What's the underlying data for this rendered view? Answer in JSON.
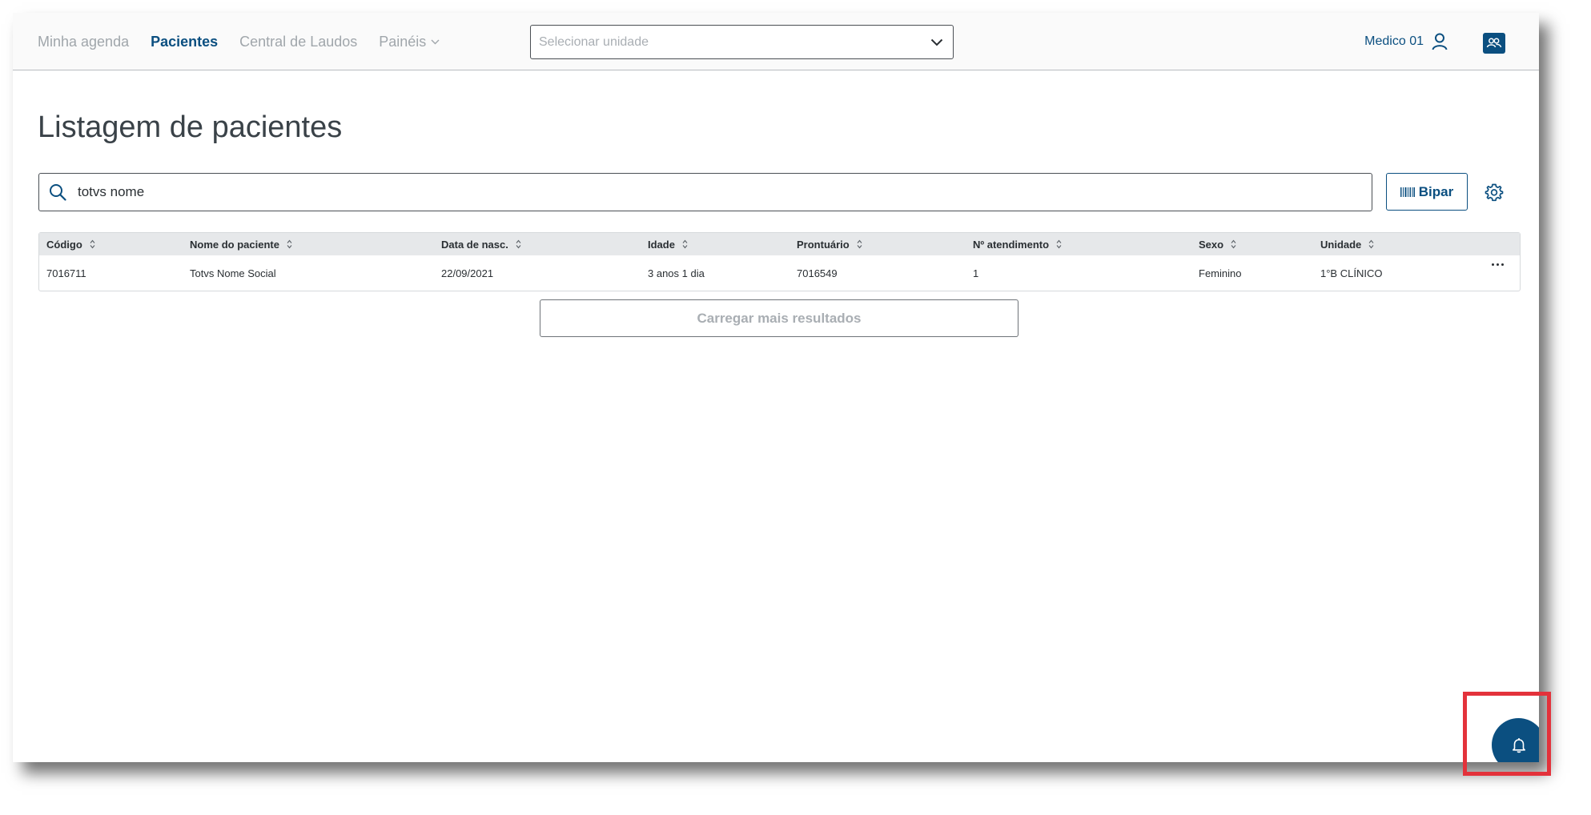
{
  "nav": {
    "items": [
      {
        "label": "Minha agenda",
        "active": false
      },
      {
        "label": "Pacientes",
        "active": true
      },
      {
        "label": "Central de Laudos",
        "active": false
      },
      {
        "label": "Painéis",
        "active": false,
        "has_dropdown": true
      }
    ]
  },
  "unit_select": {
    "placeholder": "Selecionar unidade"
  },
  "user": {
    "name": "Medico 01"
  },
  "page": {
    "title": "Listagem de pacientes"
  },
  "search": {
    "value": "totvs nome",
    "icon": "search-icon"
  },
  "bipar": {
    "label": "Bipar",
    "icon": "barcode-icon"
  },
  "table": {
    "columns": [
      "Código",
      "Nome do paciente",
      "Data de nasc.",
      "Idade",
      "Prontuário",
      "Nº atendimento",
      "Sexo",
      "Unidade"
    ],
    "rows": [
      [
        "7016711",
        "Totvs Nome Social",
        "22/09/2021",
        "3 anos 1 dia",
        "7016549",
        "1",
        "Feminino",
        "1°B CLÍNICO"
      ]
    ]
  },
  "load_more": {
    "label": "Carregar mais resultados"
  },
  "colors": {
    "brand": "#0b4f80",
    "highlight": "#e3323b"
  }
}
